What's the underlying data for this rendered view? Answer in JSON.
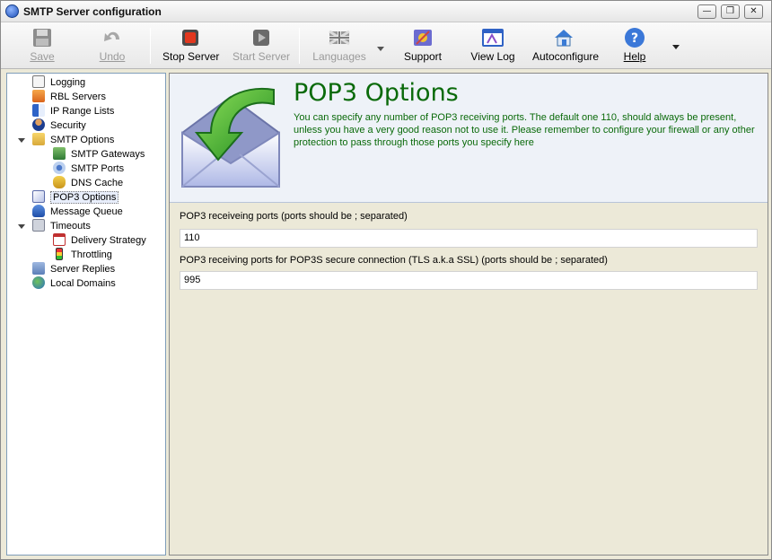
{
  "window": {
    "title": "SMTP Server configuration"
  },
  "titlebar_buttons": {
    "minimize": "—",
    "restore": "❐",
    "close": "✕"
  },
  "toolbar": {
    "save": "Save",
    "undo": "Undo",
    "stop_server": "Stop Server",
    "start_server": "Start Server",
    "languages": "Languages",
    "support": "Support",
    "view_log": "View Log",
    "autoconfigure": "Autoconfigure",
    "help": "Help"
  },
  "tree": {
    "items": [
      {
        "label": "Logging",
        "icon": "log-icon",
        "level": 0
      },
      {
        "label": "RBL Servers",
        "icon": "rbl-icon",
        "level": 0
      },
      {
        "label": "IP Range Lists",
        "icon": "ip-range-icon",
        "level": 0
      },
      {
        "label": "Security",
        "icon": "security-user-icon",
        "level": 0
      },
      {
        "label": "SMTP Options",
        "icon": "lock-folder-icon",
        "level": 0
      },
      {
        "label": "SMTP Gateways",
        "icon": "gateway-icon",
        "level": 1
      },
      {
        "label": "SMTP Ports",
        "icon": "network-ports-icon",
        "level": 1
      },
      {
        "label": "DNS Cache",
        "icon": "dns-cache-icon",
        "level": 1
      },
      {
        "label": "POP3 Options",
        "icon": "envelope-icon",
        "level": 0
      },
      {
        "label": "Message Queue",
        "icon": "queue-icon",
        "level": 0
      },
      {
        "label": "Timeouts",
        "icon": "timeout-icon",
        "level": 0
      },
      {
        "label": "Delivery Strategy",
        "icon": "calendar-icon",
        "level": 1
      },
      {
        "label": "Throttling",
        "icon": "traffic-light-icon",
        "level": 1
      },
      {
        "label": "Server Replies",
        "icon": "server-replies-icon",
        "level": 0
      },
      {
        "label": "Local Domains",
        "icon": "local-domains-icon",
        "level": 0
      }
    ],
    "selected": "POP3 Options"
  },
  "header": {
    "title": "POP3 Options",
    "description": "You can specify any number of POP3 receiving ports. The default one 110, should always be present, unless you have a very good reason not to use it. Please remember to configure your firewall or any other protection to pass through those ports you specify here",
    "accent_color": "#0a6a0a"
  },
  "form": {
    "pop3_ports_label": "POP3 receiveing ports (ports should be ; separated)",
    "pop3_ports_value": "110",
    "pop3s_ports_label": "POP3 receiving ports for POP3S secure connection (TLS a.k.a SSL)  (ports should be ; separated)",
    "pop3s_ports_value": "995"
  }
}
